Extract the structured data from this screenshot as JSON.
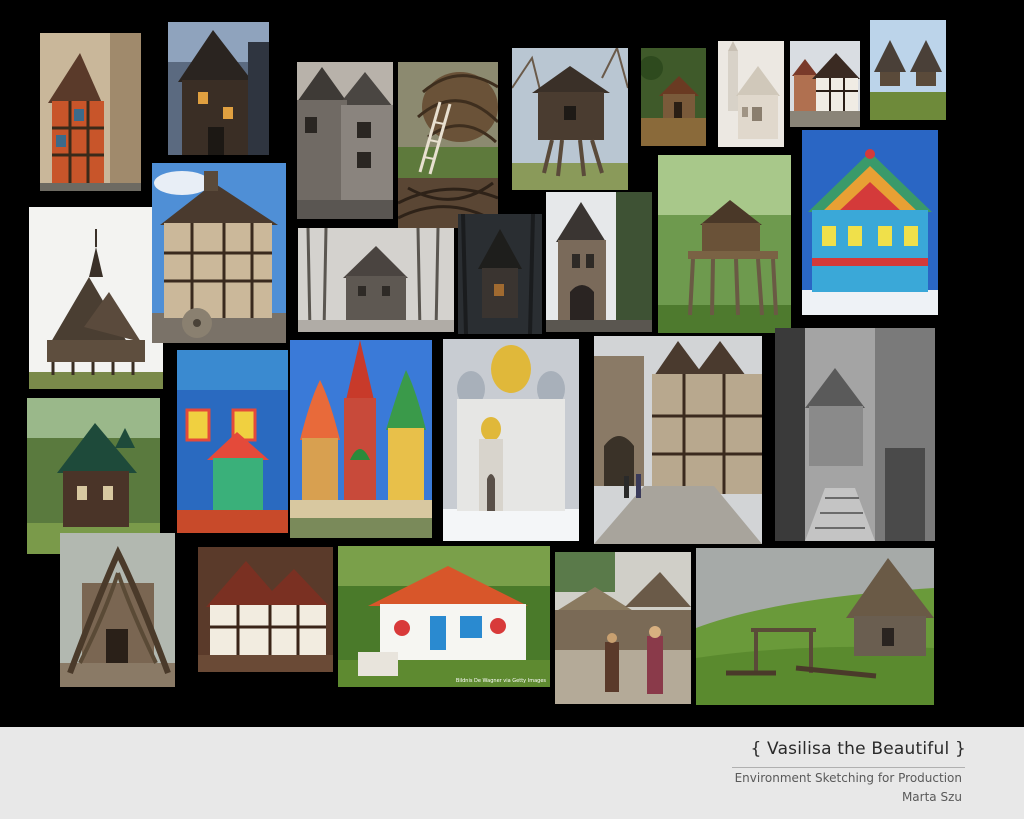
{
  "footer": {
    "title": "{ Vasilisa the Beautiful }",
    "subtitle": "Environment Sketching for Production",
    "author": "Marta Szu"
  },
  "photos": {
    "painted_cottage_credit": "Bildnis De Wagner via Getty Images"
  },
  "colors": {
    "board_background": "#000000",
    "footer_background": "#e8e8e8",
    "title_text": "#2a2a2a",
    "subtitle_text": "#5a5a5a"
  }
}
